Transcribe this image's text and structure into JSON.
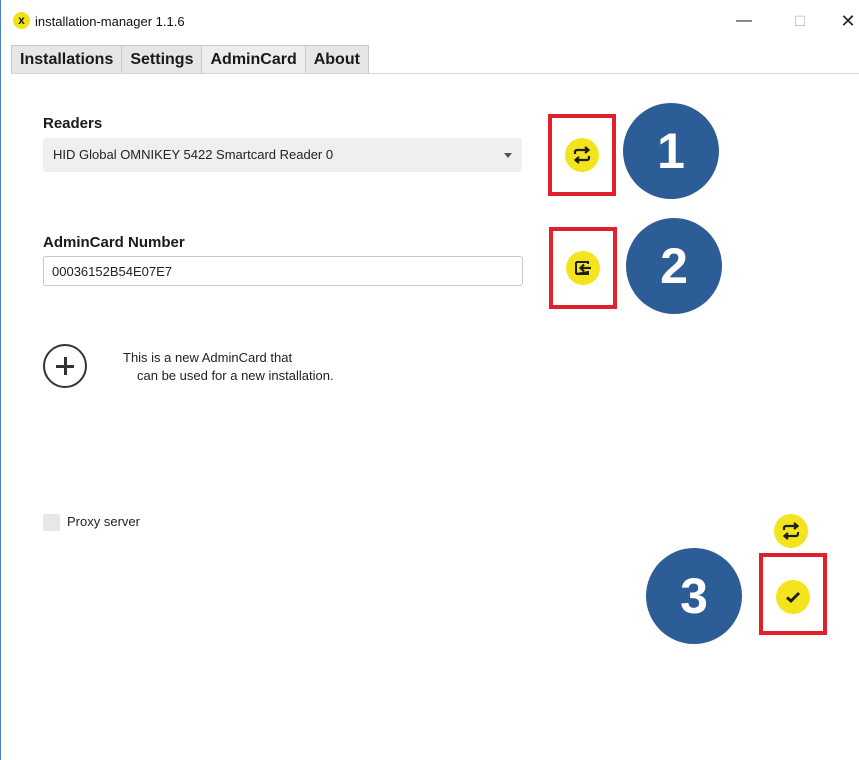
{
  "window": {
    "title": "installation-manager 1.1.6",
    "app_icon_letter": "x",
    "controls": {
      "minimize": "—",
      "maximize": "☐",
      "close": "✕"
    }
  },
  "tabs": [
    {
      "label": "Installations"
    },
    {
      "label": "Settings"
    },
    {
      "label": "AdminCard"
    },
    {
      "label": "About"
    }
  ],
  "readers": {
    "label": "Readers",
    "selected": "HID Global OMNIKEY 5422 Smartcard Reader 0",
    "refresh_icon": "refresh-icon"
  },
  "admincard": {
    "label": "AdminCard Number",
    "value": "00036152B54E07E7",
    "read_icon": "import-card-icon"
  },
  "info": {
    "icon": "plus-circle-icon",
    "text_line1": "This is a new AdminCard that",
    "text_line2": "can be used for a new installation."
  },
  "proxy": {
    "label": "Proxy server",
    "checked": false
  },
  "callouts": [
    "1",
    "2",
    "3"
  ],
  "colors": {
    "accent_yellow": "#f4e41e",
    "callout_blue": "#2d5d96",
    "highlight_red": "#e0202a"
  }
}
